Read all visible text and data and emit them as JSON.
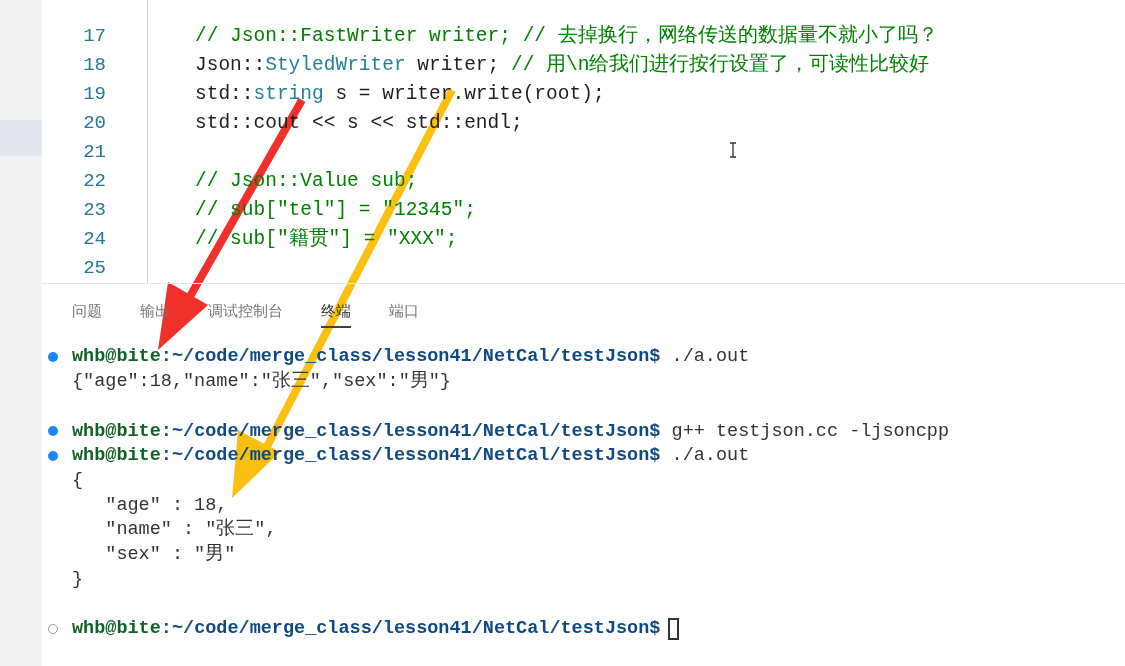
{
  "editor": {
    "lines": [
      {
        "number": "17",
        "segments": [
          {
            "kind": "comment",
            "text": "// Json::FastWriter writer; // 去掉换行，网络传送的数据量不就小了吗？"
          }
        ]
      },
      {
        "number": "18",
        "segments": [
          {
            "kind": "plain",
            "text": "Json::"
          },
          {
            "kind": "type",
            "text": "StyledWriter"
          },
          {
            "kind": "plain",
            "text": " writer; "
          },
          {
            "kind": "comment",
            "text": "// 用\\n给我们进行按行设置了，可读性比较好"
          }
        ]
      },
      {
        "number": "19",
        "segments": [
          {
            "kind": "plain",
            "text": "std::"
          },
          {
            "kind": "type",
            "text": "string"
          },
          {
            "kind": "plain",
            "text": " s = writer.write(root);"
          }
        ]
      },
      {
        "number": "20",
        "segments": [
          {
            "kind": "plain",
            "text": "std::cout << s << std::endl;"
          }
        ]
      },
      {
        "number": "21"
      },
      {
        "number": "22",
        "segments": [
          {
            "kind": "comment",
            "text": "// Json::Value sub;"
          }
        ]
      },
      {
        "number": "23",
        "segments": [
          {
            "kind": "comment",
            "text": "// sub[\"tel\"] = \"12345\";"
          }
        ]
      },
      {
        "number": "24",
        "segments": [
          {
            "kind": "comment",
            "text": "// sub[\"籍贯\"] = \"XXX\";"
          }
        ]
      },
      {
        "number": "25"
      }
    ]
  },
  "panel": {
    "tabs": [
      {
        "label": "问题",
        "selected": false
      },
      {
        "label": "输出",
        "selected": false
      },
      {
        "label": "调试控制台",
        "selected": false
      },
      {
        "label": "终端",
        "selected": true
      },
      {
        "label": "端口",
        "selected": false
      }
    ]
  },
  "terminal": {
    "lines": [
      {
        "kind": "prompt",
        "finished": true,
        "user": "whb@bite",
        "path": ":~/code/merge_class/lesson41/NetCal/testJson$",
        "command": " ./a.out"
      },
      {
        "kind": "output",
        "text": "{\"age\":18,\"name\":\"张三\",\"sex\":\"男\"}"
      },
      {
        "kind": "blank"
      },
      {
        "kind": "prompt",
        "finished": true,
        "user": "whb@bite",
        "path": ":~/code/merge_class/lesson41/NetCal/testJson$",
        "command": " g++ testjson.cc -ljsoncpp"
      },
      {
        "kind": "prompt",
        "finished": true,
        "user": "whb@bite",
        "path": ":~/code/merge_class/lesson41/NetCal/testJson$",
        "command": " ./a.out"
      },
      {
        "kind": "output",
        "text": "{"
      },
      {
        "kind": "output",
        "text": "   \"age\" : 18,"
      },
      {
        "kind": "output",
        "text": "   \"name\" : \"张三\","
      },
      {
        "kind": "output",
        "text": "   \"sex\" : \"男\""
      },
      {
        "kind": "output",
        "text": "}"
      },
      {
        "kind": "blank"
      },
      {
        "kind": "prompt",
        "finished": false,
        "user": "whb@bite",
        "path": ":~/code/merge_class/lesson41/NetCal/testJson$"
      }
    ]
  }
}
